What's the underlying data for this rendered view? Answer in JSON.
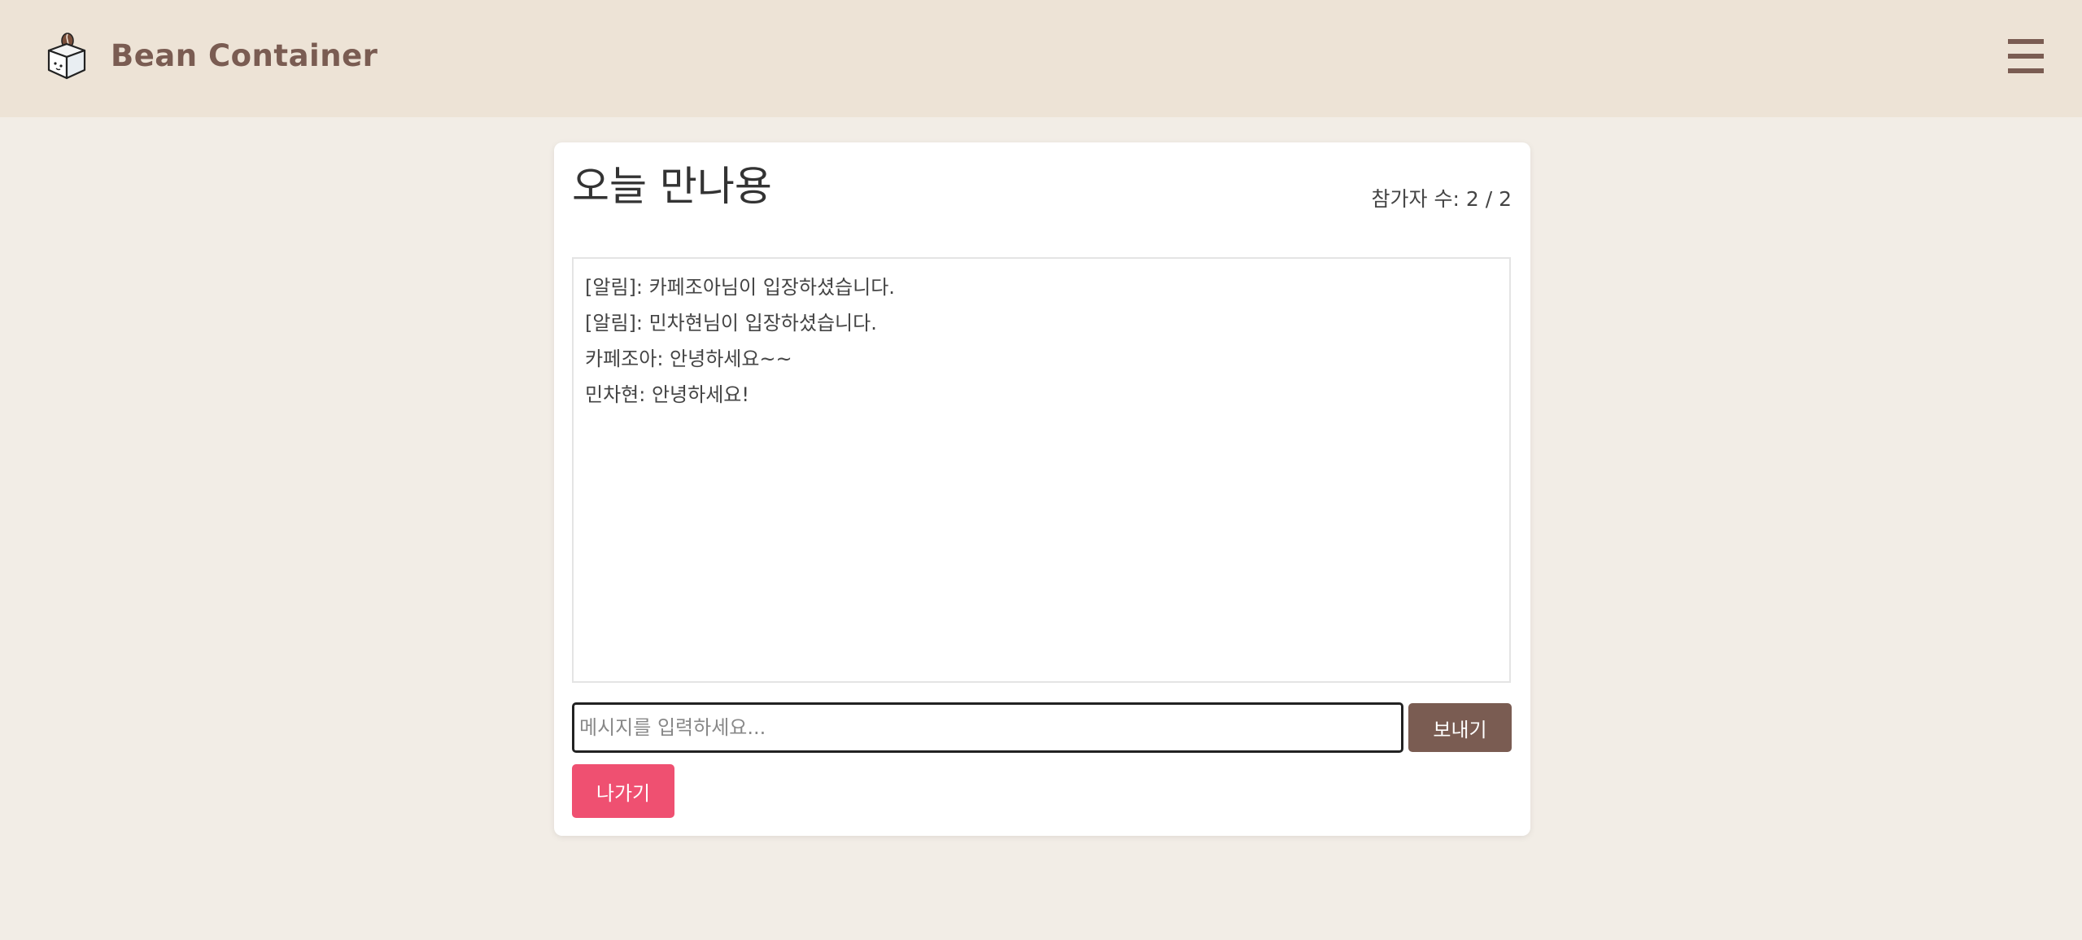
{
  "header": {
    "brand": "Bean Container",
    "logo_icon": "bean-box-icon",
    "menu_icon": "hamburger-menu-icon",
    "bg_color": "#ede3d6",
    "brand_color": "#7a5c52"
  },
  "room": {
    "title": "오늘 만나용",
    "participants_text": "참가자 수: 2 / 2"
  },
  "chat": {
    "messages": [
      "[알림]: 카페조아님이 입장하셨습니다.",
      "[알림]: 민차현님이 입장하셨습니다.",
      "카페조아: 안녕하세요~~",
      "민차현: 안녕하세요!"
    ]
  },
  "composer": {
    "placeholder": "메시지를 입력하세요...",
    "value": "",
    "send_label": "보내기",
    "send_color": "#7a5c52"
  },
  "actions": {
    "leave_label": "나가기",
    "leave_color": "#ef5071"
  },
  "page": {
    "bg_color": "#f2ede6"
  }
}
